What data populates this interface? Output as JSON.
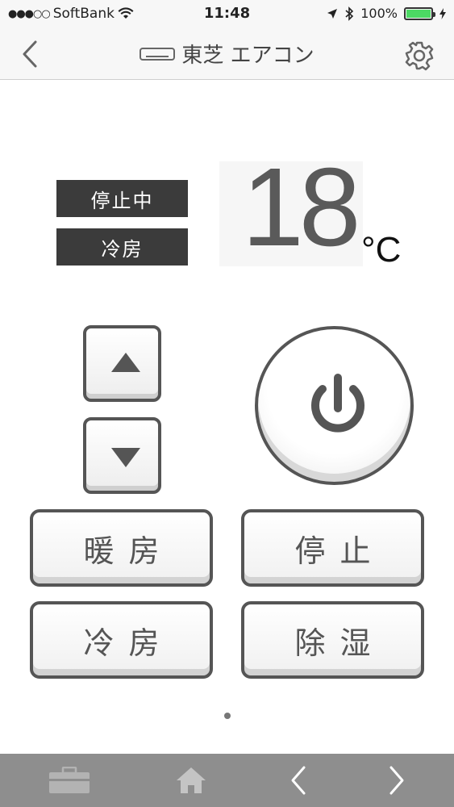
{
  "status_bar": {
    "signal_dots": "●●●○○",
    "carrier": "SoftBank",
    "time": "11:48",
    "battery_percent": "100%",
    "battery_level": 1.0,
    "icons": [
      "wifi-icon",
      "location-arrow-icon",
      "bluetooth-icon",
      "battery-icon",
      "charging-bolt-icon"
    ]
  },
  "nav": {
    "title": "東芝 エアコン",
    "title_icon": "air-conditioner-icon",
    "back_icon": "chevron-left-icon",
    "settings_icon": "gear-icon"
  },
  "status": {
    "operation": "停止中",
    "mode": "冷房"
  },
  "temperature": {
    "value": "18",
    "unit": "°C"
  },
  "controls": {
    "up_icon": "triangle-up-icon",
    "down_icon": "triangle-down-icon",
    "power_icon": "power-icon"
  },
  "modes": {
    "heat": "暖房",
    "stop": "停止",
    "cool": "冷房",
    "dehumidify": "除湿"
  },
  "toolbar": {
    "items": [
      "toolbox-icon",
      "home-icon",
      "chevron-left-icon",
      "chevron-right-icon"
    ]
  },
  "colors": {
    "label_background": "#3b3b3b",
    "button_border": "#555555",
    "toolbar_background": "#8e8e8e",
    "battery_fill": "#4cd964"
  }
}
